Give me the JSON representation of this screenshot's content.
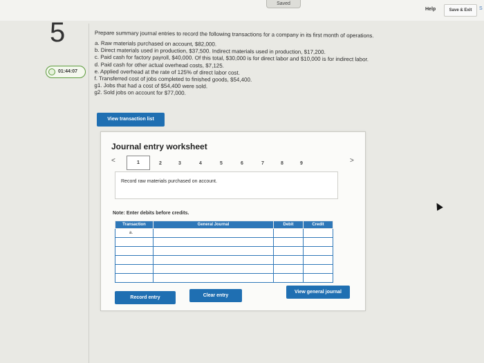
{
  "header": {
    "saved_label": "Saved",
    "help_label": "Help",
    "save_exit_label": "Save & Exit",
    "edge_label": "S"
  },
  "question": {
    "number": "5",
    "timer": "01:44:07",
    "prompt": "Prepare summary journal entries to record the following transactions for a company in its first month of operations.",
    "items": [
      "a. Raw materials purchased on account, $82,000.",
      "b. Direct materials used in production, $37,500. Indirect materials used in production, $17,200.",
      "c. Paid cash for factory payroll, $40,000. Of this total, $30,000 is for direct labor and $10,000 is for indirect labor.",
      "d. Paid cash for other actual overhead costs, $7,125.",
      "e. Applied overhead at the rate of 125% of direct labor cost.",
      "f. Transferred cost of jobs completed to finished goods, $54,400.",
      "g1. Jobs that had a cost of $54,400 were sold.",
      "g2. Sold jobs on account for $77,000."
    ]
  },
  "buttons": {
    "view_transaction_list": "View transaction list",
    "record_entry": "Record entry",
    "clear_entry": "Clear entry",
    "view_general_journal": "View general journal"
  },
  "worksheet": {
    "title": "Journal entry worksheet",
    "nav_prev": "<",
    "nav_next": ">",
    "pages": [
      "1",
      "2",
      "3",
      "4",
      "5",
      "6",
      "7",
      "8",
      "9"
    ],
    "active_page": "1",
    "description": "Record raw materials purchased on account.",
    "note": "Note: Enter debits before credits.",
    "table": {
      "headers": [
        "Transaction",
        "General Journal",
        "Debit",
        "Credit"
      ],
      "first_transaction": "a."
    }
  },
  "colors": {
    "accent_blue": "#1f6fb2",
    "table_header": "#2e77b8",
    "timer_green": "#5a9a3a"
  }
}
